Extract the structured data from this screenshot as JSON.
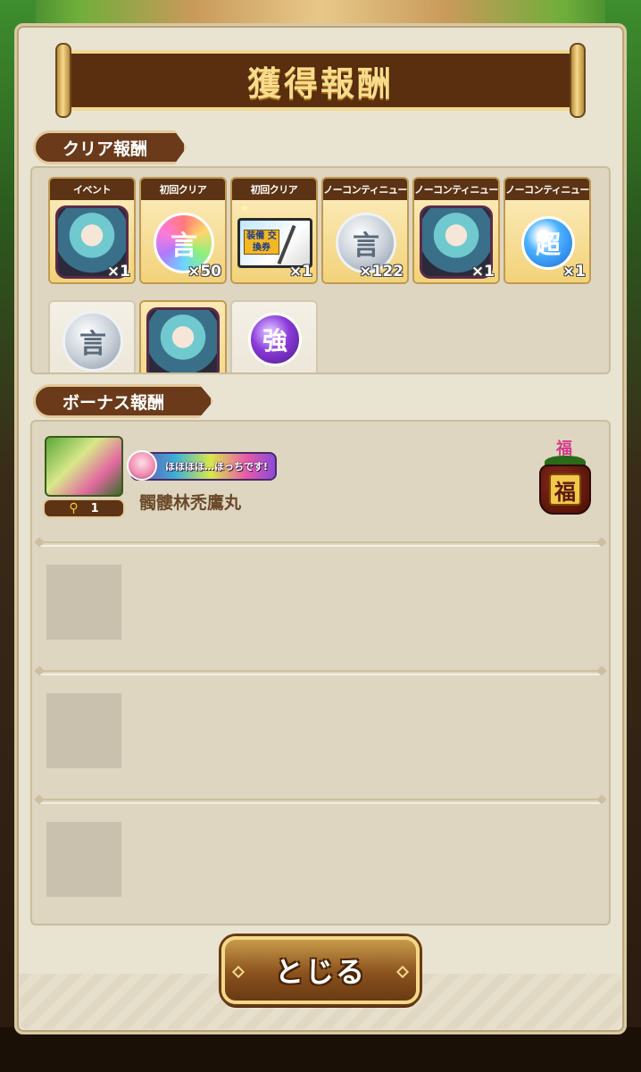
{
  "title": "獲得報酬",
  "clear_section": {
    "label": "クリア報酬",
    "rewards": [
      {
        "category": "イベント",
        "icon": "character-portrait-icon",
        "count": "×1"
      },
      {
        "category": "初回クリア",
        "icon": "rainbow-orb-icon",
        "orb_text": "言",
        "count": "×50"
      },
      {
        "category": "初回クリア",
        "icon": "equipment-ticket-icon",
        "ticket_text": "装備 交換券",
        "count": "×1"
      },
      {
        "category": "ノーコンティニュー",
        "icon": "silver-orb-icon",
        "orb_text": "言",
        "count": "×122"
      },
      {
        "category": "ノーコンティニュー",
        "icon": "character-portrait-icon",
        "count": "×1"
      },
      {
        "category": "ノーコンティニュー",
        "icon": "super-orb-icon",
        "orb_text": "超",
        "count": "×1"
      }
    ],
    "partial_rewards": [
      {
        "icon": "silver-orb-icon",
        "orb_text": "言"
      },
      {
        "icon": "character-portrait-icon"
      },
      {
        "icon": "strengthen-orb-icon",
        "orb_text": "強"
      }
    ]
  },
  "bonus_section": {
    "label": "ボーナス報酬",
    "player": {
      "level": "1",
      "title_badge": "ほほほほ…ほっちです!",
      "name": "髑髏林禿鷹丸"
    },
    "jar": {
      "tag": "福",
      "seal": "福"
    }
  },
  "close_button": {
    "label": "とじる"
  }
}
